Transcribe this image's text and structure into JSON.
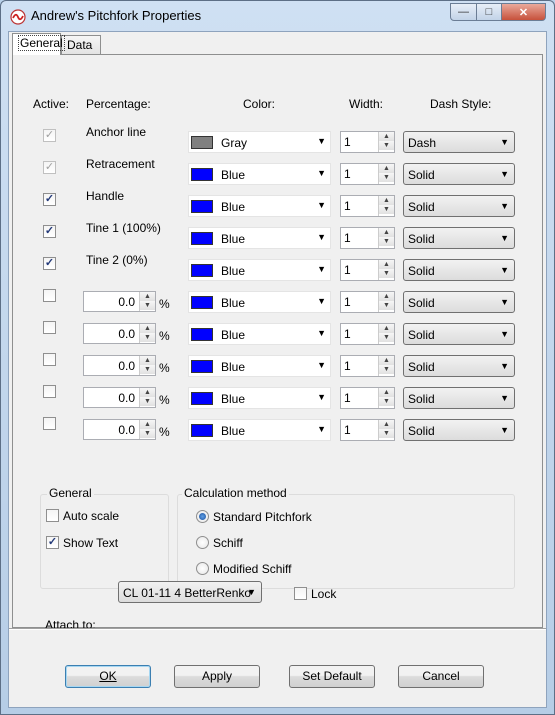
{
  "window": {
    "title": "Andrew's Pitchfork Properties",
    "min": "—",
    "max": "□",
    "close": "✕"
  },
  "tabs": [
    {
      "label": "General"
    },
    {
      "label": "Data"
    }
  ],
  "headers": {
    "active": "Active:",
    "percentage": "Percentage:",
    "color": "Color:",
    "width": "Width:",
    "dash": "Dash Style:"
  },
  "pct_sign": "%",
  "rows": [
    {
      "active": "checked-disabled",
      "label": "Anchor line",
      "color_name": "Gray",
      "color_hex": "#808080",
      "width": "1",
      "dash": "Dash"
    },
    {
      "active": "checked-disabled",
      "label": "Retracement",
      "color_name": "Blue",
      "color_hex": "#0000ff",
      "width": "1",
      "dash": "Solid"
    },
    {
      "active": "checked",
      "label": "Handle",
      "color_name": "Blue",
      "color_hex": "#0000ff",
      "width": "1",
      "dash": "Solid"
    },
    {
      "active": "checked",
      "label": "Tine 1 (100%)",
      "color_name": "Blue",
      "color_hex": "#0000ff",
      "width": "1",
      "dash": "Solid"
    },
    {
      "active": "checked",
      "label": "Tine 2 (0%)",
      "color_name": "Blue",
      "color_hex": "#0000ff",
      "width": "1",
      "dash": "Solid"
    },
    {
      "active": "unchecked",
      "percentage": "0.0",
      "color_name": "Blue",
      "color_hex": "#0000ff",
      "width": "1",
      "dash": "Solid"
    },
    {
      "active": "unchecked",
      "percentage": "0.0",
      "color_name": "Blue",
      "color_hex": "#0000ff",
      "width": "1",
      "dash": "Solid"
    },
    {
      "active": "unchecked",
      "percentage": "0.0",
      "color_name": "Blue",
      "color_hex": "#0000ff",
      "width": "1",
      "dash": "Solid"
    },
    {
      "active": "unchecked",
      "percentage": "0.0",
      "color_name": "Blue",
      "color_hex": "#0000ff",
      "width": "1",
      "dash": "Solid"
    },
    {
      "active": "unchecked",
      "percentage": "0.0",
      "color_name": "Blue",
      "color_hex": "#0000ff",
      "width": "1",
      "dash": "Solid"
    }
  ],
  "general": {
    "title": "General",
    "auto_scale": "Auto scale",
    "auto_scale_checked": false,
    "show_text": "Show Text",
    "show_text_checked": true
  },
  "calc": {
    "title": "Calculation method",
    "options": [
      "Standard Pitchfork",
      "Schiff",
      "Modified Schiff"
    ],
    "selected": "Standard Pitchfork"
  },
  "attach": {
    "label": "Attach to:",
    "value": "CL 01-11  4 BetterRenko",
    "lock": "Lock",
    "lock_checked": false
  },
  "buttons": {
    "ok": "OK",
    "apply": "Apply",
    "set_default": "Set Default",
    "cancel": "Cancel"
  },
  "colors": {
    "window_frame": "#b6cde6",
    "client": "#f0f0f0",
    "default_button_border": "#3c7fb1"
  }
}
